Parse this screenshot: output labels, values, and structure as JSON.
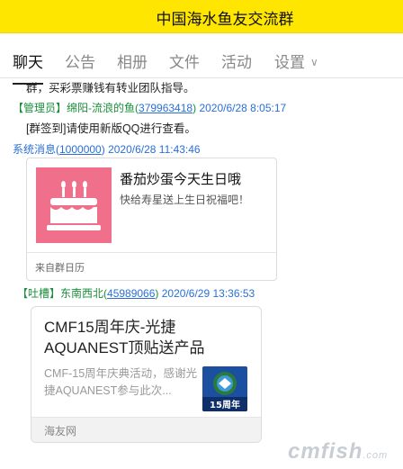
{
  "header": {
    "title": "中国海水鱼友交流群"
  },
  "tabs": [
    {
      "label": "聊天",
      "active": true
    },
    {
      "label": "公告"
    },
    {
      "label": "相册"
    },
    {
      "label": "文件"
    },
    {
      "label": "活动"
    },
    {
      "label": "设置",
      "has_dropdown": true
    }
  ],
  "messages": {
    "m1": {
      "text": "群，买彩票赚钱有转业团队指导。"
    },
    "m2": {
      "tag": "【管理员】",
      "name": "绵阳-流浪的鱼(",
      "id": "379963418",
      "name_end": ")",
      "time": "2020/6/28 8:05:17"
    },
    "m3": {
      "text": "[群签到]请使用新版QQ进行查看。"
    },
    "m4": {
      "name": "系统消息(",
      "id": "1000000",
      "name_end": ")",
      "time": "2020/6/28 11:43:46"
    },
    "m5": {
      "tag": "【吐槽】",
      "name": "东南西北(",
      "id": "45989066",
      "name_end": ")",
      "time": "2020/6/29 13:36:53"
    }
  },
  "birthday_card": {
    "title": "番茄炒蛋今天生日哦",
    "subtitle": "快给寿星送上生日祝福吧！",
    "source": "来自群日历",
    "icon": "birthday-cake-icon"
  },
  "article_card": {
    "title": "CMF15周年庆-光捷AQUANEST顶贴送产品",
    "summary": "CMF-15周年庆典活动，感谢光捷AQUANEST参与此次...",
    "thumb_text": "15周年",
    "source": "海友网"
  },
  "watermark": {
    "text": "cmfish",
    "suffix": ".com"
  },
  "colors": {
    "header_bg": "#ffe600",
    "green": "#1a8f3a",
    "blue": "#2a6fd6",
    "cake_bg": "#f0708b"
  }
}
